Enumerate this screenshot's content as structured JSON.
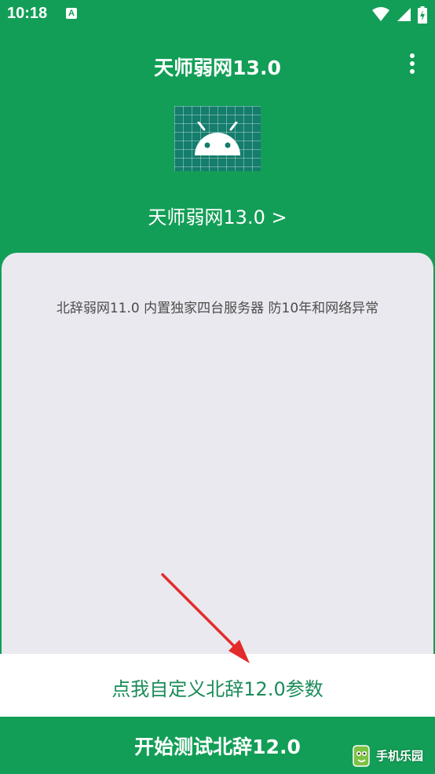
{
  "status_bar": {
    "time": "10:18",
    "notification_badge": "A",
    "icons": [
      "wifi-icon",
      "signal-icon",
      "battery-charging-icon"
    ]
  },
  "app_bar": {
    "title": "天师弱网13.0",
    "menu_icon": "more-vertical-icon"
  },
  "app_info": {
    "logo_icon": "android-icon",
    "link_label": "天师弱网13.0 >"
  },
  "content": {
    "description": "北辞弱网11.0 内置独家四台服务器 防10年和网络异常"
  },
  "actions": {
    "custom_label": "点我自定义北辞12.0参数",
    "start_label": "开始测试北辞12.0"
  },
  "watermark": {
    "text": "手机乐园"
  },
  "colors": {
    "primary": "#129e56",
    "card_background": "#e9e9ef",
    "custom_text": "#1b8b58",
    "annotation_arrow": "#e32b2b"
  }
}
